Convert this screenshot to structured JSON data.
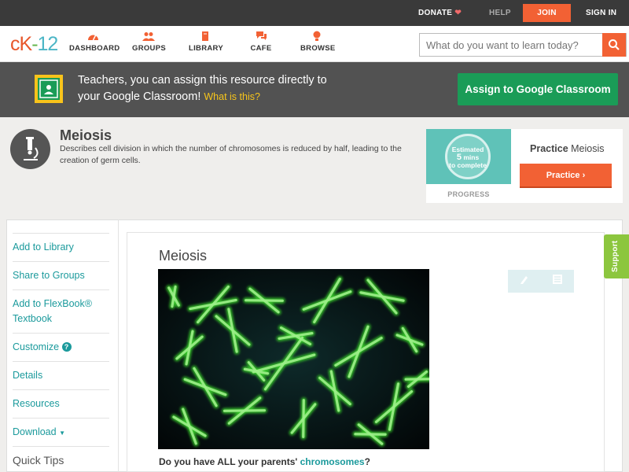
{
  "topbar": {
    "donate": "DONATE",
    "help": "HELP",
    "join": "JOIN",
    "signin": "SIGN IN"
  },
  "logo": {
    "c": "cK",
    "dash": "-",
    "num": "12"
  },
  "nav": {
    "items": [
      {
        "label": "DASHBOARD",
        "icon": "dashboard-icon"
      },
      {
        "label": "GROUPS",
        "icon": "groups-icon"
      },
      {
        "label": "LIBRARY",
        "icon": "library-icon"
      },
      {
        "label": "CAFE",
        "icon": "cafe-icon"
      },
      {
        "label": "BROWSE",
        "icon": "browse-icon"
      }
    ],
    "search_placeholder": "What do you want to learn today?"
  },
  "banner": {
    "line1": "Teachers, you can assign this resource directly to",
    "line2": "your Google Classroom!",
    "what": "What is this?",
    "assign_label": "Assign to Google Classroom"
  },
  "concept": {
    "title": "Meiosis",
    "description": "Describes cell division in which the number of chromosomes is reduced by half, leading to the creation of germ cells."
  },
  "practice": {
    "estimated": "Estimated",
    "mins": "5",
    "mins_label": "mins",
    "to_complete": "to complete",
    "progress_label": "PROGRESS",
    "title_bold": "Practice",
    "title_rest": "Meiosis",
    "button_label": "Practice"
  },
  "sidebar": {
    "items": [
      "Add to Library",
      "Share to Groups",
      "Add to FlexBook® Textbook",
      "Customize",
      "Details",
      "Resources",
      "Download",
      "Quick Tips"
    ]
  },
  "content": {
    "title": "Meiosis",
    "question_pre": "Do you have ALL your parents'",
    "question_link": "chromosomes",
    "question_post": "?"
  },
  "support": "Support",
  "colors": {
    "accent": "#f26134",
    "teal": "#1b9a9c",
    "green": "#1a9c57",
    "support": "#8cc63e"
  }
}
